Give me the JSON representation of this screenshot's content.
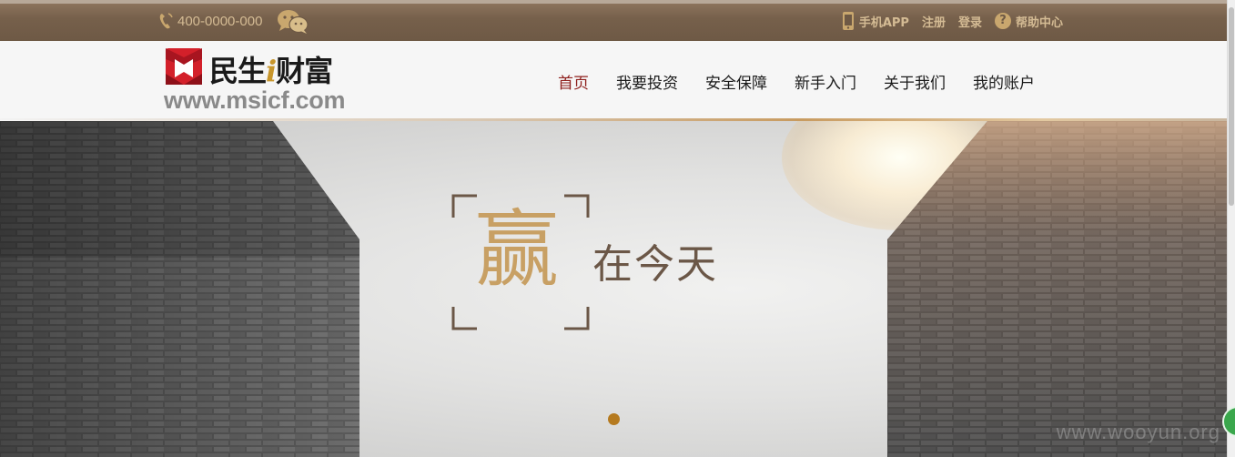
{
  "topbar": {
    "phone": "400-0000-000",
    "links": [
      {
        "label": "手机APP"
      },
      {
        "label": "注册"
      },
      {
        "label": "登录"
      },
      {
        "label": "帮助中心"
      }
    ]
  },
  "logo": {
    "cn_text": "民生",
    "i_letter": "i",
    "cn_text2": "财富",
    "url": "www.msicf.com"
  },
  "nav": {
    "items": [
      {
        "label": "首页",
        "active": true
      },
      {
        "label": "我要投资"
      },
      {
        "label": "安全保障"
      },
      {
        "label": "新手入门"
      },
      {
        "label": "关于我们"
      },
      {
        "label": "我的账户"
      }
    ]
  },
  "hero": {
    "slogan_big": "赢",
    "slogan_small": "在今天",
    "slide_indicator": {
      "current": 1
    }
  },
  "watermark": "www.wooyun.org",
  "colors": {
    "topbar_bg": "#76604b",
    "topbar_text": "#d4bb94",
    "nav_active": "#8e1f1c",
    "slogan_gold": "#c8a064",
    "slogan_brown": "#6b5747",
    "dot": "#b57a1f",
    "logo_red": "#d3202a"
  }
}
